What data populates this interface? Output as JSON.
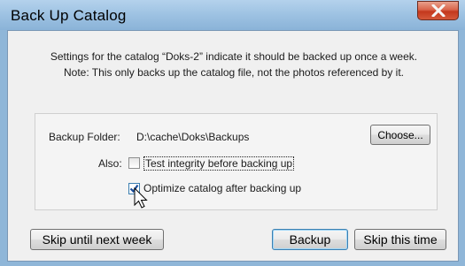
{
  "window": {
    "title": "Back Up Catalog",
    "close_icon": "close-x-icon"
  },
  "message": {
    "line1": "Settings for the catalog “Doks-2” indicate it should be backed up once a week.",
    "line2": "Note: This only backs up the catalog file, not the photos referenced by it."
  },
  "backup_folder": {
    "label": "Backup Folder:",
    "path": "D:\\cache\\Doks\\Backups",
    "choose_label": "Choose..."
  },
  "also": {
    "label": "Also:",
    "test_integrity": {
      "label": "Test integrity before backing up",
      "checked": false
    },
    "optimize": {
      "label": "Optimize catalog after backing up",
      "checked": true
    }
  },
  "buttons": {
    "skip_week": "Skip until next week",
    "backup": "Backup",
    "skip_time": "Skip this time"
  },
  "colors": {
    "titlebar": "#9fc3e3",
    "close": "#c3381d",
    "dialog_bg": "#f0f0f0",
    "check_accent": "#3c7fb1"
  }
}
